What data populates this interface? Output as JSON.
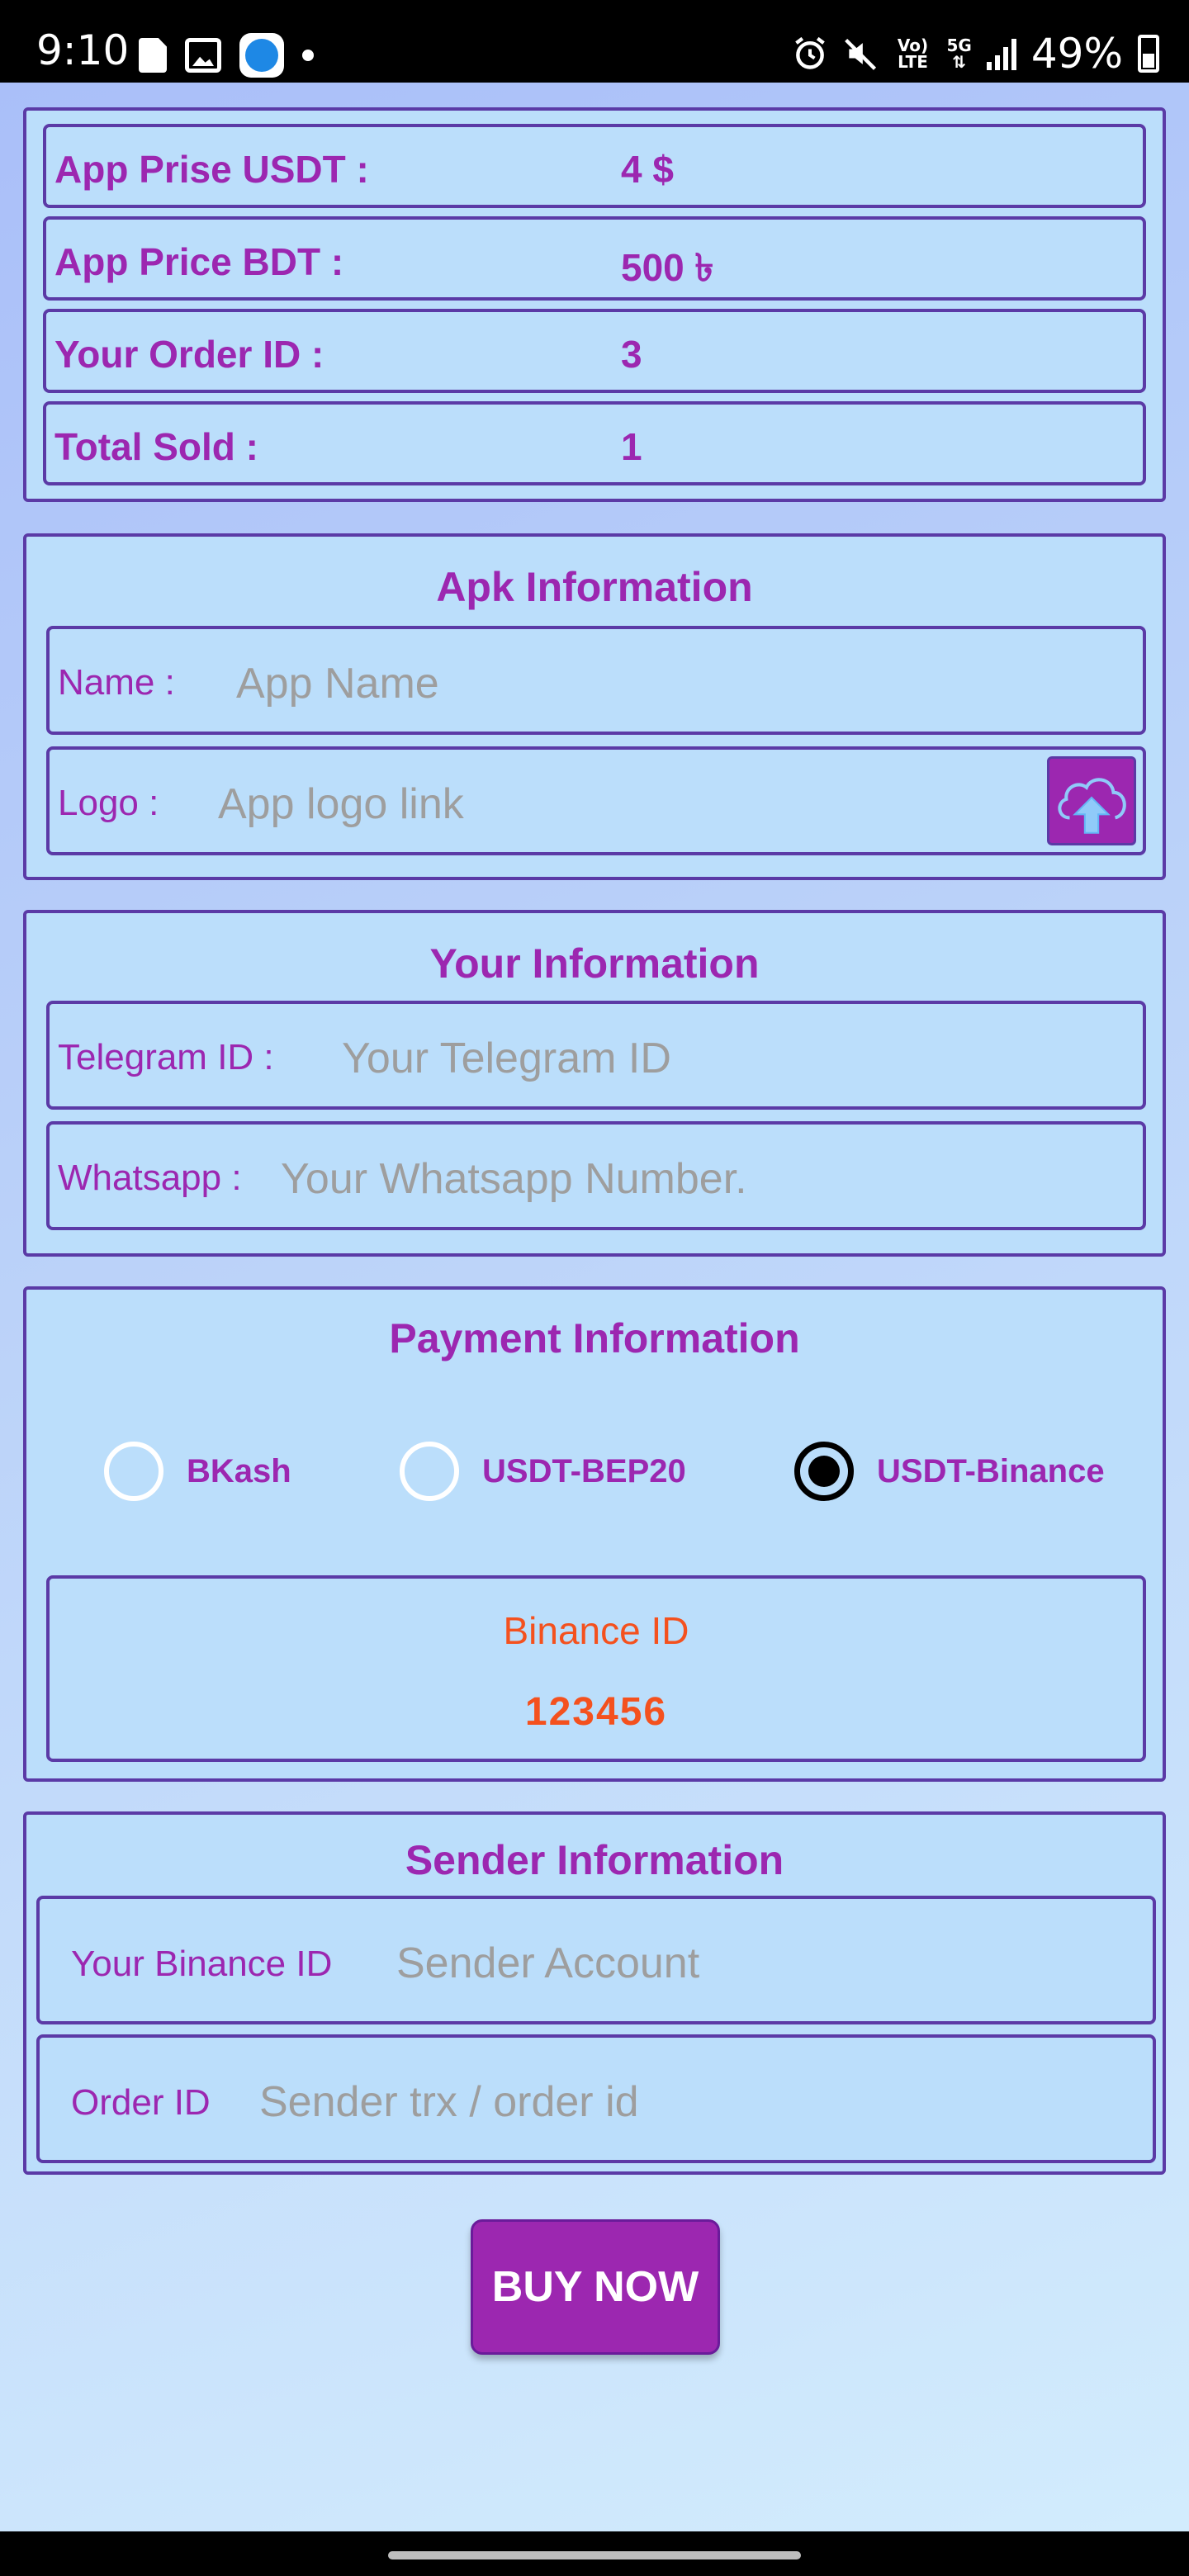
{
  "status_bar": {
    "time": "9:10",
    "battery": "49%",
    "network_top": "5G",
    "volte": "Vo) LTE"
  },
  "price_panel": {
    "rows": [
      {
        "label": "App Prise USDT :",
        "value": "4 $"
      },
      {
        "label": "App Price BDT :",
        "value": "500 ৳"
      },
      {
        "label": "Your Order ID :",
        "value": "3"
      },
      {
        "label": "Total Sold :",
        "value": "1"
      }
    ]
  },
  "apk_info": {
    "title": "Apk Information",
    "name_label": "Name :",
    "name_placeholder": "App Name",
    "logo_label": "Logo :",
    "logo_placeholder": "App logo link",
    "upload_icon": "cloud-upload-icon"
  },
  "your_info": {
    "title": "Your Information",
    "telegram_label": "Telegram ID :",
    "telegram_placeholder": "Your Telegram ID",
    "whatsapp_label": "Whatsapp :",
    "whatsapp_placeholder": "Your Whatsapp Number."
  },
  "payment_info": {
    "title": "Payment Information",
    "options": [
      {
        "label": "BKash",
        "selected": false
      },
      {
        "label": "USDT-BEP20",
        "selected": false
      },
      {
        "label": "USDT-Binance",
        "selected": true
      }
    ],
    "account_title": "Binance ID",
    "account_value": "123456"
  },
  "sender_info": {
    "title": "Sender Information",
    "account_label": "Your Binance ID",
    "account_placeholder": "Sender Account",
    "order_label": "Order ID",
    "order_placeholder": "Sender trx / order id"
  },
  "buy_button": "BUY NOW",
  "colors": {
    "accent": "#9c27b0",
    "border": "#5b3aa6",
    "highlight": "#f4511e",
    "panel": "#bbdefb"
  }
}
